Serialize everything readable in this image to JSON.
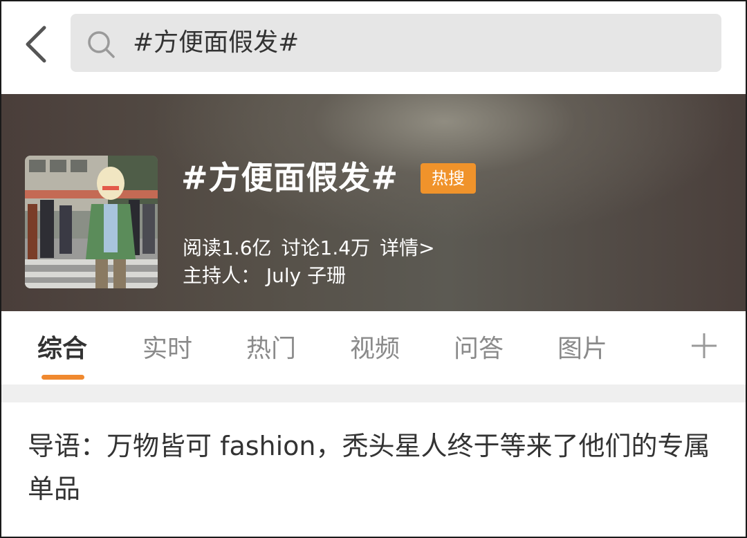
{
  "search": {
    "query": "#方便面假发#"
  },
  "topic": {
    "title": "#方便面假发#",
    "badge": "热搜",
    "reads": "阅读1.6亿",
    "discussions": "讨论1.4万",
    "details": "详情>",
    "host": "主持人：  July 子珊"
  },
  "tabs": [
    {
      "label": "综合",
      "active": true
    },
    {
      "label": "实时"
    },
    {
      "label": "热门"
    },
    {
      "label": "视频"
    },
    {
      "label": "问答"
    },
    {
      "label": "图片"
    }
  ],
  "lead": {
    "text": "导语：万物皆可 fashion，秃头星人终于等来了他们的专属单品"
  },
  "colors": {
    "accent": "#f0892f",
    "badge": "#f0932b",
    "search_bg": "#e6e6e6",
    "separator": "#efefef"
  },
  "icons": [
    "back-icon",
    "search-icon",
    "plus-icon"
  ]
}
